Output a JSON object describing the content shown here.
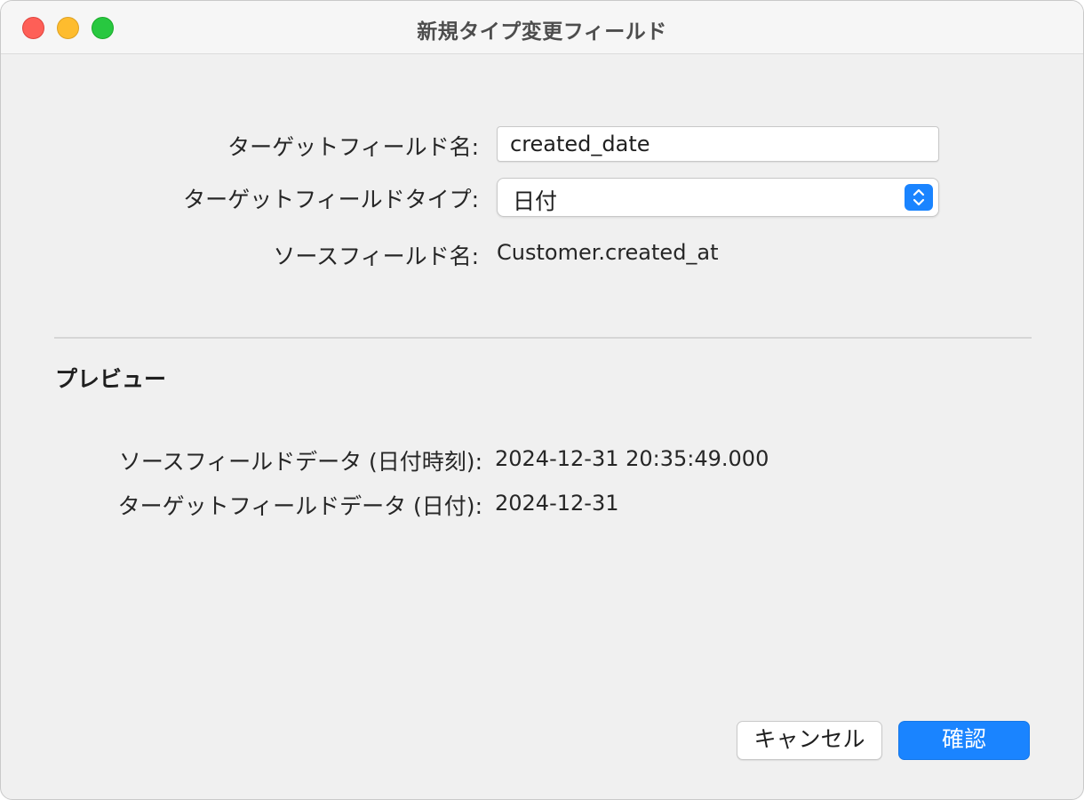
{
  "window": {
    "title": "新規タイプ変更フィールド"
  },
  "form": {
    "target_name_label": "ターゲットフィールド名:",
    "target_name_value": "created_date",
    "target_type_label": "ターゲットフィールドタイプ:",
    "target_type_value": "日付",
    "source_name_label": "ソースフィールド名:",
    "source_name_value": "Customer.created_at"
  },
  "preview": {
    "title": "プレビュー",
    "source_data_label": "ソースフィールドデータ (日付時刻):",
    "source_data_value": "2024-12-31 20:35:49.000",
    "target_data_label": "ターゲットフィールドデータ (日付):",
    "target_data_value": "2024-12-31"
  },
  "buttons": {
    "cancel": "キャンセル",
    "confirm": "確認"
  },
  "colors": {
    "accent": "#1a84ff",
    "window_background": "#f0f0f0",
    "close": "#fe5f57",
    "minimize": "#febc2e",
    "zoom": "#28c840"
  },
  "icons": {
    "popup_stepper": "chevron-up-down-icon"
  }
}
